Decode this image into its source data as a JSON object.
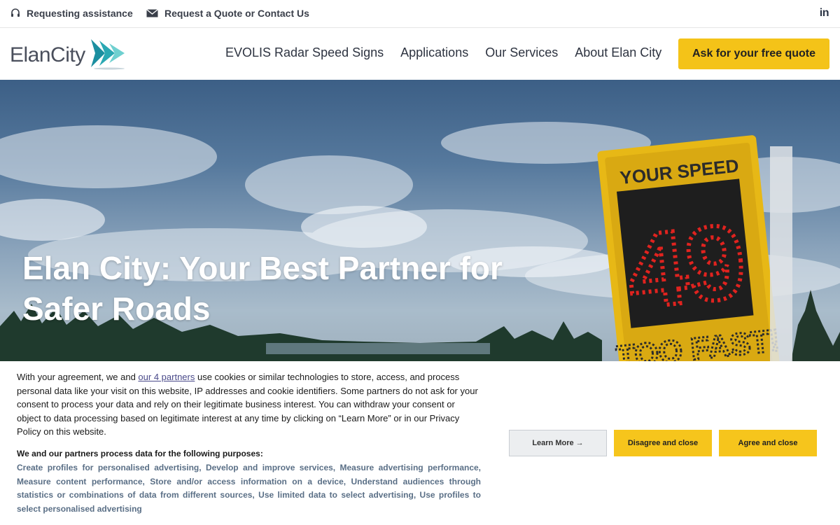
{
  "topbar": {
    "assistance_label": "Requesting assistance",
    "contact_label": "Request a Quote or Contact Us",
    "social_label": "in"
  },
  "header": {
    "logo_text": "ElanCity",
    "nav": [
      "EVOLIS Radar Speed Signs",
      "Applications",
      "Our Services",
      "About Elan City"
    ],
    "cta_label": "Ask for your free quote"
  },
  "hero": {
    "title": "Elan City: Your Best Partner for Safer Roads",
    "sign_top": "YOUR SPEED",
    "sign_speed": "49",
    "sign_bottom": "TOO FAST!"
  },
  "cookie": {
    "text_before": "With your agreement, we and ",
    "partners_link": "our 4 partners",
    "text_after": " use cookies or similar technologies to store, access, and process personal data like your visit on this website, IP addresses and cookie identifiers. Some partners do not ask for your consent to process your data and rely on their legitimate business interest. You can withdraw your consent or object to data processing based on legitimate interest at any time by clicking on “Learn More” or in our Privacy Policy on this website.",
    "purposes_title": "We and our partners process data for the following purposes:",
    "purposes": "Create profiles for personalised advertising, Develop and improve services, Measure advertising performance, Measure content performance, Store and/or access information on a device, Understand audiences through statistics or combinations of data from different sources, Use limited data to select advertising, Use profiles to select personalised advertising",
    "learn_more": "Learn More →",
    "disagree": "Disagree and close",
    "agree": "Agree and close"
  },
  "colors": {
    "accent": "#f4c318",
    "text_dark": "#2d3340",
    "purposes_text": "#5a6f86",
    "led_red": "#e0231f"
  }
}
